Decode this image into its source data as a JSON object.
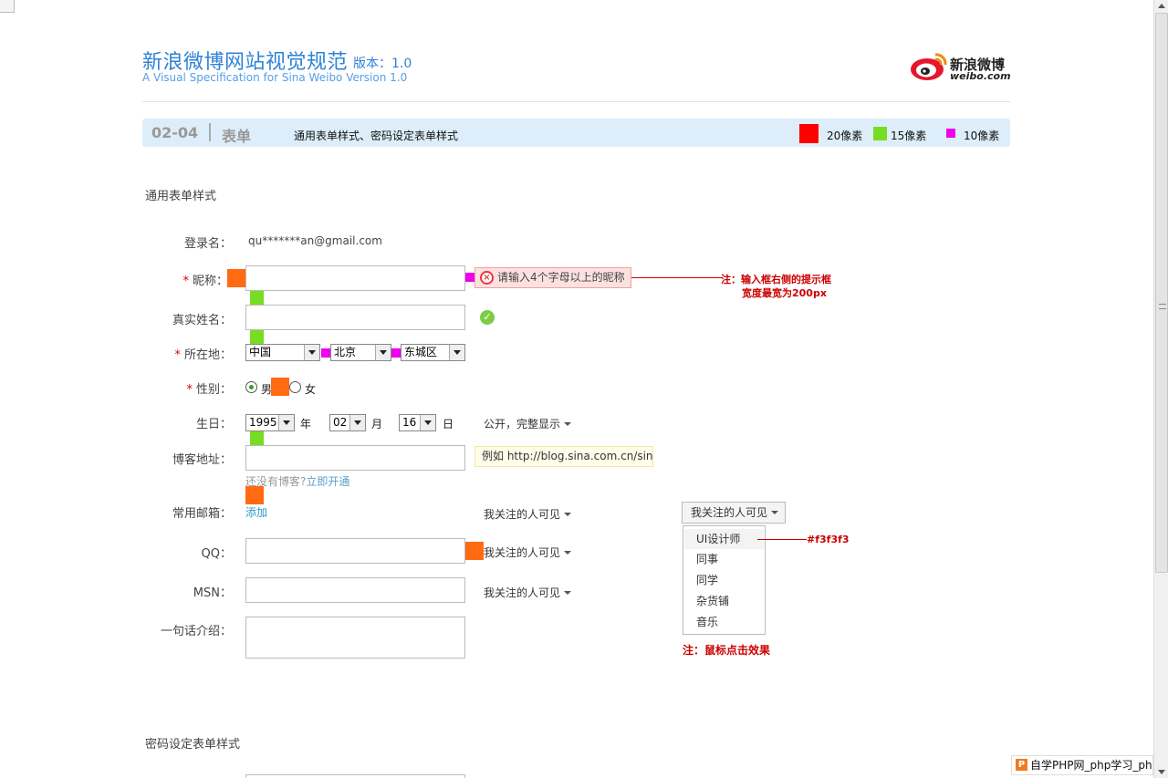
{
  "header": {
    "title_cn": "新浪微博网站视觉规范",
    "version": "版本：1.0",
    "title_en": "A Visual Specification for Sina Weibo   Version 1.0",
    "logo_cn": "新浪微博",
    "logo_en": "weibo.com"
  },
  "band": {
    "number": "02-04",
    "name": "表单",
    "desc": "通用表单样式、密码设定表单样式",
    "legend": [
      {
        "label": "20像素",
        "color": "#ff0000"
      },
      {
        "label": "15像素",
        "color": "#77dd22"
      },
      {
        "label": "10像素",
        "color": "#ee00ee"
      }
    ]
  },
  "sections": {
    "general": "通用表单样式",
    "password": "密码设定表单样式"
  },
  "form": {
    "login_label": "登录名：",
    "login_value": "qu*******an@gmail.com",
    "nick_required": "*",
    "nick_label": "昵称：",
    "nick_error": "请输入4个字母以上的昵称",
    "realname_label": "真实姓名：",
    "location_required": "*",
    "location_label": "所在地：",
    "location_country": "中国",
    "location_province": "北京",
    "location_district": "东城区",
    "gender_required": "*",
    "gender_label": "性别：",
    "gender_male": "男",
    "gender_female": "女",
    "birthday_label": "生日：",
    "birth_year": "1995",
    "year_unit": "年",
    "birth_month": "02",
    "month_unit": "月",
    "birth_day": "16",
    "day_unit": "日",
    "birthday_visibility": "公开，完整显示",
    "blog_label": "博客地址：",
    "blog_hint": "例如 http://blog.sina.com.cn/sinat",
    "blog_none": "还没有博客?",
    "blog_open_link": "立即开通",
    "email_label": "常用邮箱：",
    "email_add_link": "添加",
    "email_visibility": "我关注的人可见",
    "qq_label": "QQ：",
    "qq_visibility": "我关注的人可见",
    "msn_label": "MSN：",
    "msn_visibility": "我关注的人可见",
    "intro_label": "一句话介绍："
  },
  "dropdown": {
    "button_label": "我关注的人可见",
    "items": [
      "UI设计师",
      "同事",
      "同学",
      "杂货铺",
      "音乐"
    ],
    "highlight_index": 0
  },
  "notes": {
    "tip_line1": "注：输入框右侧的提示框",
    "tip_line2": "宽度最宽为200px",
    "hover_color": "#f3f3f3",
    "click_effect": "注：鼠标点击效果"
  },
  "watermark": {
    "text": "自学PHP网_php学习_php教"
  },
  "colors": {
    "accent_blue": "#2f83d6",
    "band_bg": "#ddeefa",
    "spacer_20": "#ff6a13",
    "spacer_15": "#77dd22",
    "spacer_10": "#ee00ee"
  }
}
